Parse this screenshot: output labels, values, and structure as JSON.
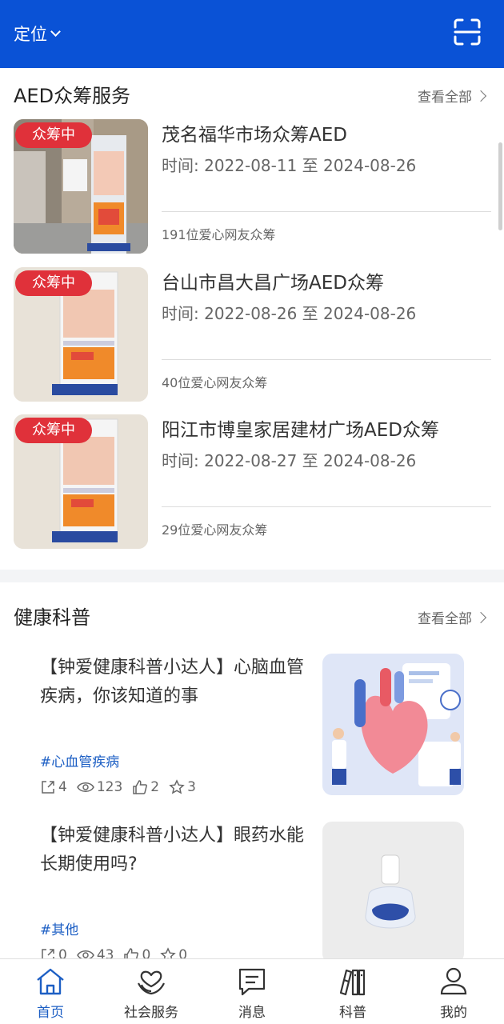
{
  "header": {
    "location_label": "定位",
    "bg_color": "#0a52d6"
  },
  "aed_section": {
    "title": "AED众筹服务",
    "see_all": "查看全部",
    "items": [
      {
        "badge": "众筹中",
        "title": "茂名福华市场众筹AED",
        "time": "时间: 2022-08-11 至 2024-08-26",
        "count": "191位爱心网友众筹"
      },
      {
        "badge": "众筹中",
        "title": "台山市昌大昌广场AED众筹",
        "time": "时间: 2022-08-26 至 2024-08-26",
        "count": "40位爱心网友众筹"
      },
      {
        "badge": "众筹中",
        "title": "阳江市博皇家居建材广场AED众筹",
        "time": "时间: 2022-08-27 至 2024-08-26",
        "count": "29位爱心网友众筹"
      }
    ]
  },
  "health_section": {
    "title": "健康科普",
    "see_all": "查看全部",
    "articles": [
      {
        "title": "【钟爱健康科普小达人】心脑血管疾病，你该知道的事",
        "tag": "#心血管疾病",
        "shares": "4",
        "views": "123",
        "likes": "2",
        "stars": "3"
      },
      {
        "title": "【钟爱健康科普小达人】眼药水能长期使用吗?",
        "tag": "#其他",
        "shares": "0",
        "views": "43",
        "likes": "0",
        "stars": "0"
      }
    ]
  },
  "bottom_nav": [
    {
      "label": "首页",
      "icon": "home-icon",
      "active": true
    },
    {
      "label": "社会服务",
      "icon": "heart-hands-icon",
      "active": false
    },
    {
      "label": "消息",
      "icon": "message-icon",
      "active": false
    },
    {
      "label": "科普",
      "icon": "books-icon",
      "active": false
    },
    {
      "label": "我的",
      "icon": "user-icon",
      "active": false
    }
  ],
  "colors": {
    "accent": "#1d5fc4",
    "badge": "#e0313a"
  }
}
